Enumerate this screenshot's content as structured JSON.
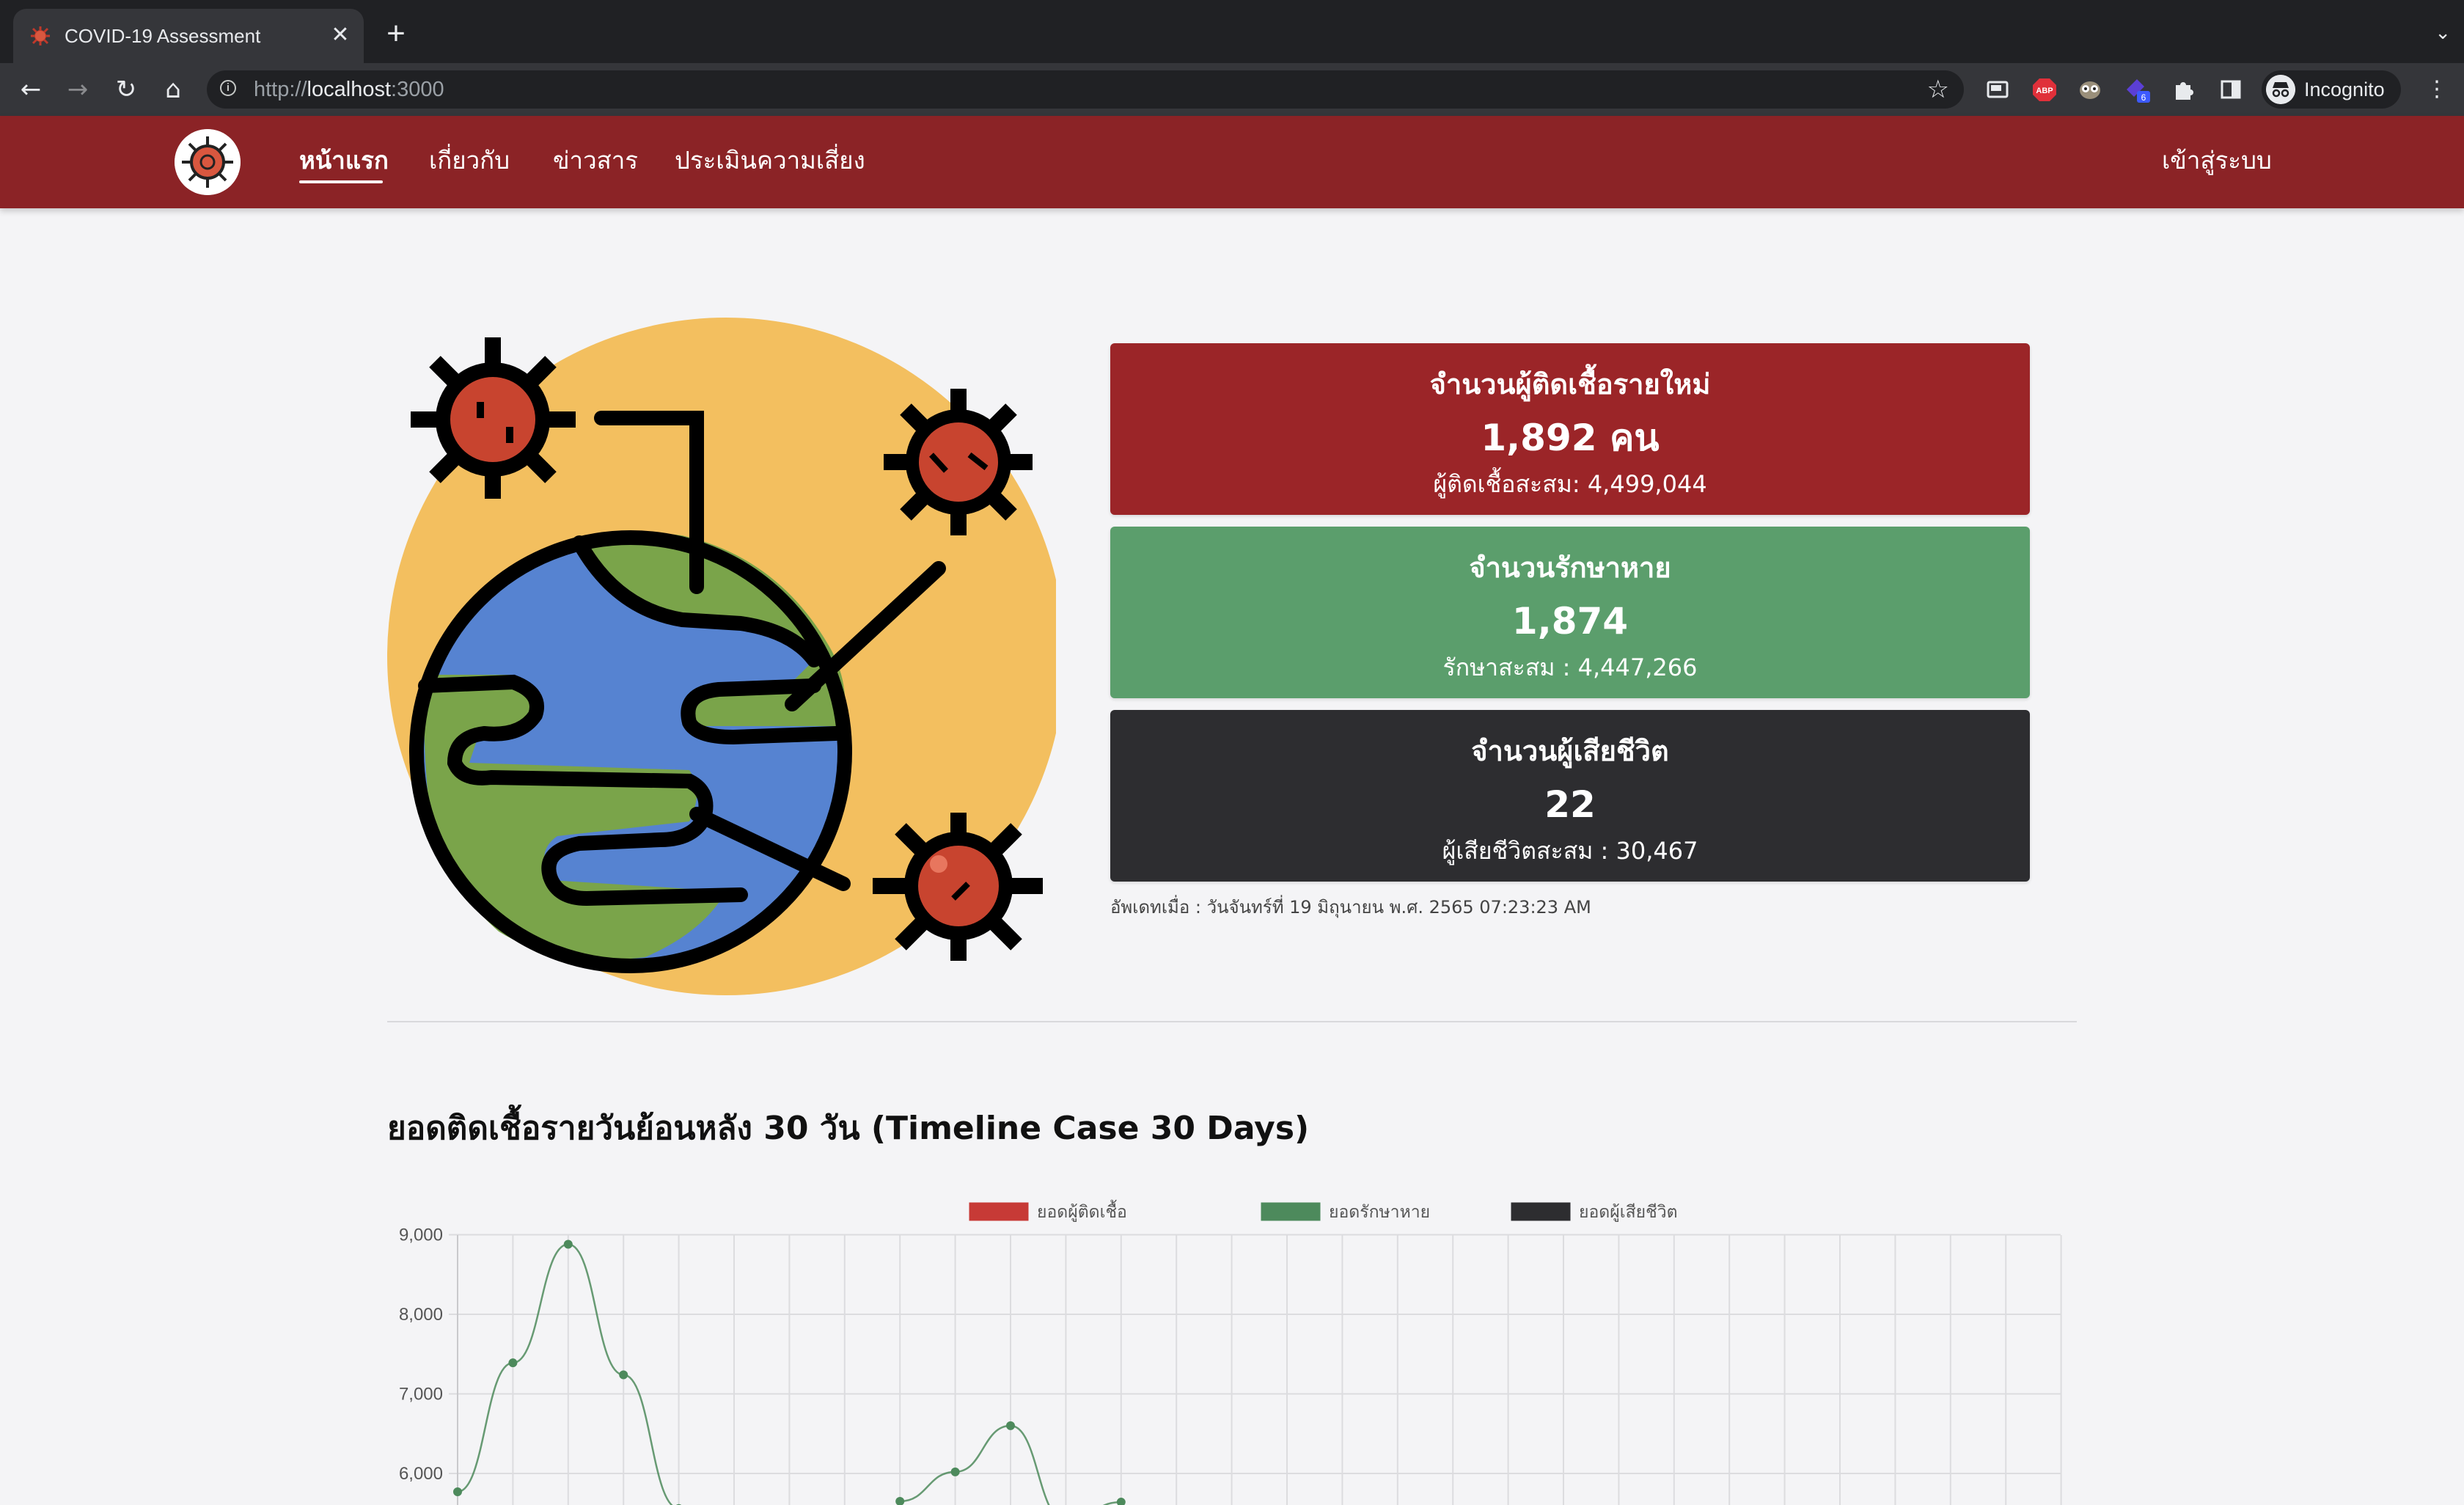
{
  "browser": {
    "tab_title": "COVID-19 Assessment",
    "url_scheme": "http://",
    "url_host": "localhost",
    "url_port": ":3000",
    "profile_label": "Incognito",
    "extension_badge": "6"
  },
  "nav": {
    "links": [
      "หน้าแรก",
      "เกี่ยวกับ",
      "ข่าวสาร",
      "ประเมินความเสี่ยง"
    ],
    "login": "เข้าสู่ระบบ"
  },
  "stats": {
    "new_cases": {
      "title": "จำนวนผู้ติดเชื้อรายใหม่",
      "value": "1,892 คน",
      "total": "ผู้ติดเชื้อสะสม: 4,499,044"
    },
    "recovered": {
      "title": "จำนวนรักษาหาย",
      "value": "1,874",
      "total": "รักษาสะสม : 4,447,266"
    },
    "deaths": {
      "title": "จำนวนผู้เสียชีวิต",
      "value": "22",
      "total": "ผู้เสียชีวิตสะสม : 30,467"
    },
    "updated": "อัพเดทเมื่อ : วันจันทร์ที่ 19 มิถุนายน พ.ศ. 2565 07:23:23 AM"
  },
  "colors": {
    "nav": "#8b2326",
    "new_cases": "#9b2528",
    "recovered": "#5b9e6c",
    "deaths": "#2d2d30"
  },
  "chart_data": {
    "type": "line",
    "title": "ยอดติดเชื้อรายวันย้อนหลัง 30 วัน (Timeline Case 30 Days)",
    "series": [
      {
        "name": "ยอดผู้ติดเชื้อ",
        "color": "#c73a36",
        "values": []
      },
      {
        "name": "ยอดรักษาหาย",
        "color": "#4d8a5c",
        "values": [
          5770,
          7390,
          8880,
          7240,
          5560,
          5520,
          null,
          null,
          5650,
          6020,
          6600,
          5400,
          5640
        ]
      },
      {
        "name": "ยอดผู้เสียชีวิต",
        "color": "#2d2d30",
        "values": []
      }
    ],
    "y_ticks": [
      "9,000",
      "8,000",
      "7,000",
      "6,000"
    ],
    "y_tick_values": [
      9000,
      8000,
      7000,
      6000
    ],
    "ylim_visible": [
      5600,
      9000
    ],
    "grid": true,
    "legend": "top-center"
  }
}
